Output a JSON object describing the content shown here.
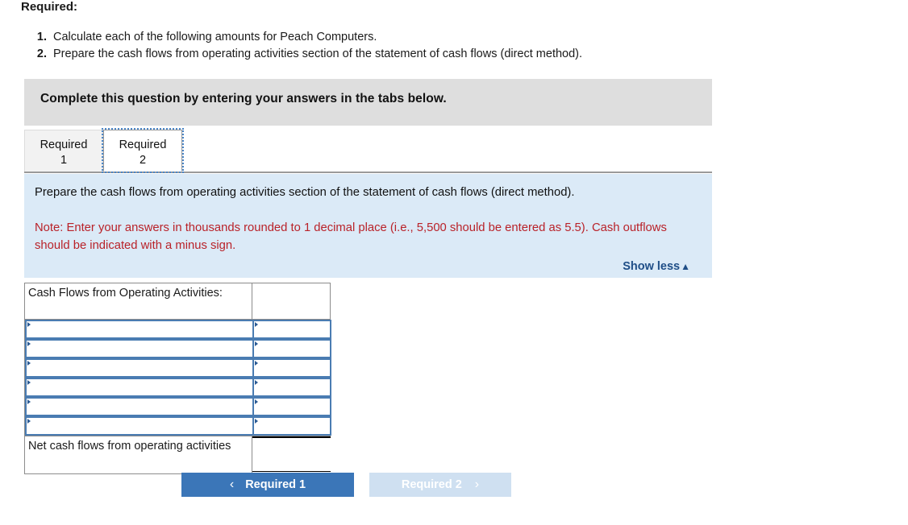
{
  "heading": "Required:",
  "requirements": [
    {
      "num": "1.",
      "text": "Calculate each of the following amounts for Peach Computers."
    },
    {
      "num": "2.",
      "text": "Prepare the cash flows from operating activities section of the statement of cash flows (direct method)."
    }
  ],
  "banner": {
    "text": "Complete this question by entering your answers in the tabs below."
  },
  "tabs": [
    {
      "line1": "Required",
      "line2": "1",
      "state": "inactive"
    },
    {
      "line1": "Required",
      "line2": "2",
      "state": "active"
    }
  ],
  "instructions": {
    "prompt": "Prepare the cash flows from operating activities section of the statement of cash flows (direct method).",
    "note": "Note: Enter your answers in thousands rounded to 1 decimal place (i.e., 5,500 should be entered as 5.5). Cash outflows should be indicated with a minus sign.",
    "show_less_label": "Show less",
    "show_less_caret": "▲"
  },
  "answer_table": {
    "header_label": "Cash Flows from Operating Activities:",
    "header_amount": "",
    "input_rows": [
      {
        "label": "",
        "amount": ""
      },
      {
        "label": "",
        "amount": ""
      },
      {
        "label": "",
        "amount": ""
      },
      {
        "label": "",
        "amount": ""
      },
      {
        "label": "",
        "amount": ""
      },
      {
        "label": "",
        "amount": ""
      }
    ],
    "total_label": "Net cash flows from operating activities",
    "total_amount": ""
  },
  "nav": {
    "prev_label": "Required 1",
    "prev_chevron": "‹",
    "next_label": "Required 2",
    "next_chevron": "›"
  },
  "colors": {
    "banner_gray": "#dedede",
    "panel_blue": "#dbeaf7",
    "note_red": "#b92229",
    "link_navy": "#1f4e87",
    "button_blue": "#3b76b8",
    "button_disabled_blue": "#cfe0f1",
    "input_border_blue": "#4a7cb2"
  }
}
